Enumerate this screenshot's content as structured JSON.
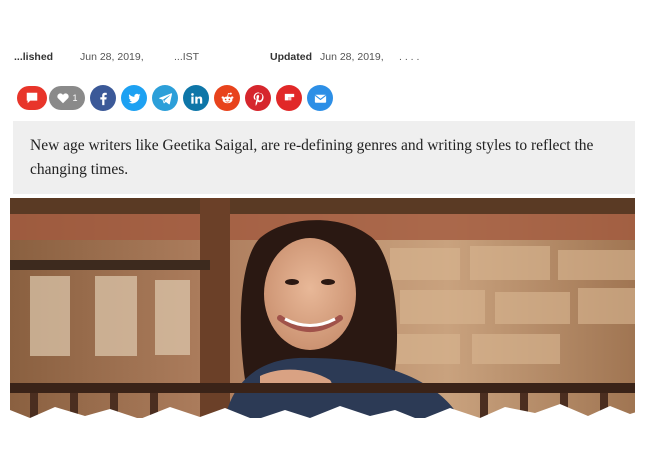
{
  "meta": {
    "published_label": "...lished",
    "published_date": "Jun 28, 2019,",
    "published_time": "...IST",
    "updated_label": "Updated",
    "updated_date": "Jun 28, 2019,",
    "updated_time": ". . . ."
  },
  "share": {
    "comment_icon": "comment-icon",
    "like_count": "1",
    "buttons": [
      {
        "name": "facebook",
        "icon": "facebook-icon",
        "color": "#3b5998"
      },
      {
        "name": "twitter",
        "icon": "twitter-icon",
        "color": "#1da1f2"
      },
      {
        "name": "telegram",
        "icon": "telegram-icon",
        "color": "#2c9fd9"
      },
      {
        "name": "linkedin",
        "icon": "linkedin-icon",
        "color": "#0e76a8"
      },
      {
        "name": "reddit",
        "icon": "reddit-icon",
        "color": "#e8431c"
      },
      {
        "name": "pinterest",
        "icon": "pinterest-icon",
        "color": "#d6262d"
      },
      {
        "name": "flipboard",
        "icon": "flipboard-icon",
        "color": "#e12828"
      },
      {
        "name": "email",
        "icon": "email-icon",
        "color": "#2d8fe6"
      }
    ]
  },
  "article": {
    "summary": "New age writers like Geetika Saigal, are re-defining genres and writing styles to reflect the changing times."
  },
  "colors": {
    "comment_red": "#e8352a",
    "like_gray": "#8a8a8a",
    "summary_bg": "#efefef"
  }
}
